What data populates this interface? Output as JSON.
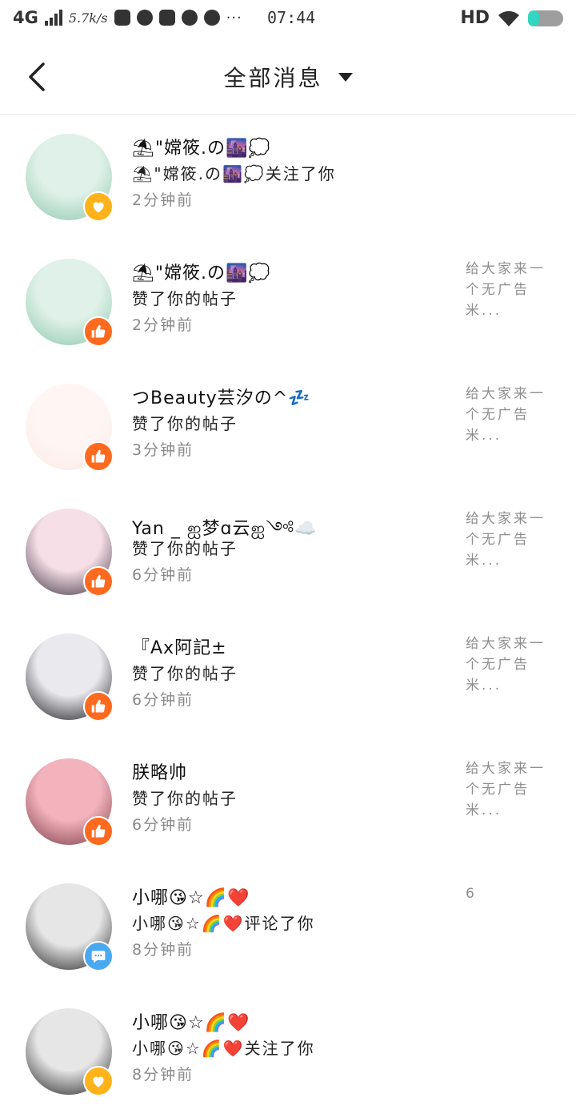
{
  "status_bar": {
    "network": "4G",
    "speed": "5.7k/s",
    "time": "07:44",
    "hd": "HD",
    "dots": "···"
  },
  "header": {
    "title": "全部消息"
  },
  "messages": [
    {
      "name": "⛱\"嫦筱.の🌆💭",
      "action": "⛱\"嫦筱.の🌆💭关注了你",
      "time": "2分钟前",
      "preview": "",
      "badge": "heart",
      "avatar_colors": [
        "#dff1e8",
        "#8dc6ad"
      ]
    },
    {
      "name": "⛱\"嫦筱.の🌆💭",
      "action": "赞了你的帖子",
      "time": "2分钟前",
      "preview": "给大家来一个无广告米...",
      "badge": "thumb",
      "avatar_colors": [
        "#dff1e8",
        "#8dc6ad"
      ]
    },
    {
      "name": "つBeauty芸汐の^💤",
      "action": "赞了你的帖子",
      "time": "3分钟前",
      "preview": "给大家来一个无广告米...",
      "badge": "thumb",
      "avatar_colors": [
        "#fff6f4",
        "#fbe9e6"
      ]
    },
    {
      "name": "Yan _ ஐ梦ɑ云ஐ༺☁️",
      "action": "赞了你的帖子",
      "time": "6分钟前",
      "preview": "给大家来一个无广告米...",
      "badge": "thumb",
      "avatar_colors": [
        "#f6dfe6",
        "#3a2f3f"
      ]
    },
    {
      "name": "『Ax阿記±",
      "action": "赞了你的帖子",
      "time": "6分钟前",
      "preview": "给大家来一个无广告米...",
      "badge": "thumb",
      "avatar_colors": [
        "#e9e9ee",
        "#141418"
      ]
    },
    {
      "name": "朕略帅",
      "action": "赞了你的帖子",
      "time": "6分钟前",
      "preview": "给大家来一个无广告米...",
      "badge": "thumb",
      "avatar_colors": [
        "#f3b3bd",
        "#7a3a44"
      ]
    },
    {
      "name": "小哪😘☆🌈❤️",
      "action": "小哪😘☆🌈❤️评论了你",
      "time": "8分钟前",
      "preview": "6",
      "badge": "comment",
      "avatar_colors": [
        "#e6e6e6",
        "#1e1e1e"
      ]
    },
    {
      "name": "小哪😘☆🌈❤️",
      "action": "小哪😘☆🌈❤️关注了你",
      "time": "8分钟前",
      "preview": "",
      "badge": "heart",
      "avatar_colors": [
        "#e6e6e6",
        "#1e1e1e"
      ]
    }
  ]
}
